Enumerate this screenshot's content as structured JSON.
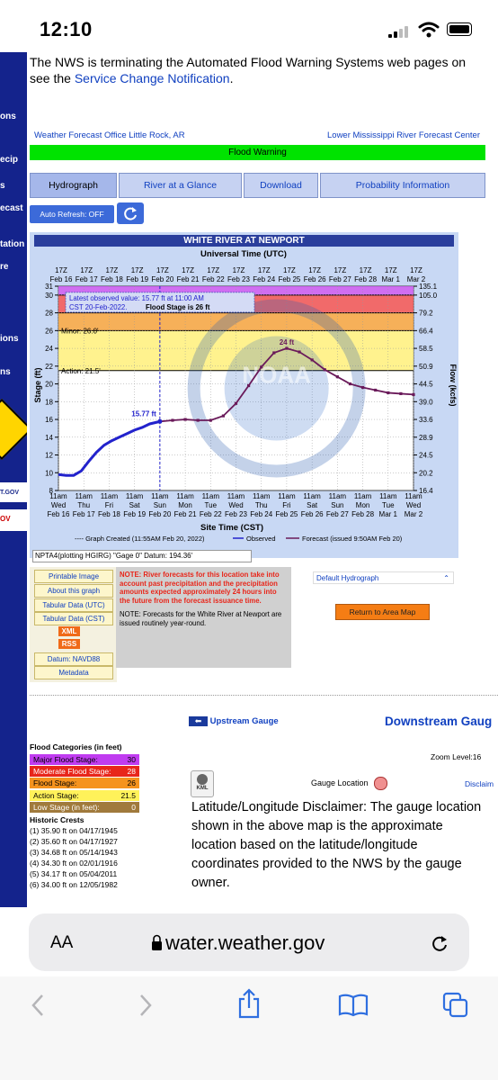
{
  "status_bar": {
    "time": "12:10"
  },
  "notice": {
    "line1": "The NWS is terminating the Automated Flood Warning Systems web pages on",
    "line2_prefix": "see the ",
    "line2_link": "Service Change Notification",
    "line2_suffix": "."
  },
  "left_nav": [
    "ons",
    "ecip",
    "s",
    "ecast",
    "tation",
    "re",
    "ions",
    "ns",
    "T.GOV",
    "OV"
  ],
  "header": {
    "office_link": "Weather Forecast Office Little Rock, AR",
    "rfc_link": "Lower Mississippi River Forecast Center",
    "banner": "Flood Warning"
  },
  "tabs": [
    "Hydrograph",
    "River at a Glance",
    "Download",
    "Probability Information"
  ],
  "auto_refresh": {
    "label": "Auto Refresh: OFF"
  },
  "chart": {
    "title": "WHITE RIVER AT NEWPORT",
    "top_axis_title": "Universal Time (UTC)",
    "top_ticks": [
      "17Z",
      "17Z",
      "17Z",
      "17Z",
      "17Z",
      "17Z",
      "17Z",
      "17Z",
      "17Z",
      "17Z",
      "17Z",
      "17Z",
      "17Z",
      "17Z",
      "17Z"
    ],
    "top_dates": [
      "Feb 16",
      "Feb 17",
      "Feb 18",
      "Feb 19",
      "Feb 20",
      "Feb 21",
      "Feb 22",
      "Feb 23",
      "Feb 24",
      "Feb 25",
      "Feb 26",
      "Feb 27",
      "Feb 28",
      "Mar 1",
      "Mar 2"
    ],
    "ylabel_left": "Stage (ft)",
    "ylabel_right": "Flow (kcfs)",
    "left_ticks": [
      "8",
      "10",
      "12",
      "14",
      "16",
      "18",
      "20",
      "22",
      "24",
      "26",
      "28",
      "30",
      "31"
    ],
    "right_ticks": [
      "16.4",
      "20.2",
      "24.5",
      "28.9",
      "33.6",
      "39.0",
      "44.5",
      "50.9",
      "58.5",
      "66.4",
      "79.2",
      "105.0",
      "135.1"
    ],
    "bottom_time_ticks": [
      "11am",
      "11am",
      "11am",
      "11am",
      "11am",
      "11am",
      "11am",
      "11am",
      "11am",
      "11am",
      "11am",
      "11am",
      "11am",
      "11am",
      "11am"
    ],
    "bottom_day_ticks": [
      "Wed",
      "Thu",
      "Fri",
      "Sat",
      "Sun",
      "Mon",
      "Tue",
      "Wed",
      "Thu",
      "Fri",
      "Sat",
      "Sun",
      "Mon",
      "Tue",
      "Wed"
    ],
    "bottom_date_ticks": [
      "Feb 16",
      "Feb 17",
      "Feb 18",
      "Feb 19",
      "Feb 20",
      "Feb 21",
      "Feb 22",
      "Feb 23",
      "Feb 24",
      "Feb 25",
      "Feb 26",
      "Feb 27",
      "Feb 28",
      "Mar 1",
      "Mar 2"
    ],
    "xlabel": "Site Time (CST)",
    "legend_created": "---- Graph Created (11:55AM Feb 20, 2022)",
    "legend_observed": "Observed",
    "legend_forecast": "Forecast (issued 9:50AM Feb 20)",
    "latest_line1": "Latest observed value: 15.77 ft at 11:00 AM",
    "latest_line2": "CST 20-Feb-2022.",
    "latest_flood": "Flood Stage is 26 ft",
    "minor_label": "Minor: 26.0'",
    "action_label": "Action: 21.5'",
    "obs_point_label": "15.77 ft",
    "crest_label": "24 ft",
    "noaa_text": "NOAA",
    "footer": "NPTA4(plotting HGIRG) \"Gage 0\" Datum: 194.36'"
  },
  "chart_data": {
    "type": "line",
    "title": "WHITE RIVER AT NEWPORT",
    "xlabel": "Site Time (CST)",
    "ylabel": "Stage (ft)",
    "ylim": [
      8,
      31
    ],
    "x_start": "Feb 16 11am",
    "x_end": "Mar 2 11am",
    "thresholds": {
      "major": 30,
      "moderate": 28,
      "minor": 26.0,
      "action": 21.5
    },
    "series": [
      {
        "name": "Observed",
        "color": "#2222cc",
        "x_days": [
          0.0,
          0.3,
          0.6,
          0.9,
          1.2,
          1.5,
          1.8,
          2.1,
          2.4,
          2.7,
          3.0,
          3.3,
          3.6,
          3.9,
          4.0
        ],
        "y": [
          9.8,
          9.7,
          9.7,
          10.2,
          11.3,
          12.3,
          13.1,
          13.6,
          14.0,
          14.4,
          14.8,
          15.1,
          15.5,
          15.7,
          15.77
        ]
      },
      {
        "name": "Forecast",
        "color": "#6a1a5a",
        "x_days": [
          4.0,
          4.5,
          5.0,
          5.5,
          6.0,
          6.5,
          7.0,
          7.5,
          8.0,
          8.5,
          9.0,
          9.5,
          10.0,
          10.5,
          11.0,
          11.5,
          12.0,
          12.5,
          13.0,
          13.5,
          14.0
        ],
        "y": [
          15.77,
          15.9,
          16.0,
          15.9,
          15.9,
          16.4,
          17.8,
          19.8,
          21.9,
          23.5,
          24.0,
          23.6,
          22.7,
          21.6,
          20.8,
          20.0,
          19.6,
          19.3,
          19.0,
          18.9,
          18.8
        ]
      }
    ]
  },
  "left_buttons": [
    "Printable Image",
    "About this graph",
    "Tabular Data (UTC)",
    "Tabular Data (CST)",
    "XML",
    "RSS",
    "Datum: NAVD88",
    "Metadata"
  ],
  "note_red": "NOTE: River forecasts for this location take into account past precipitation and the precipitation amounts expected approximately 24 hours into the future from the forecast issuance time.",
  "note_black": "NOTE: Forecasts for the White River at Newport are issued routinely year-round.",
  "select": {
    "value": "Default Hydrograph"
  },
  "return_btn": "Return to Area Map",
  "upstream": "Upstream Gauge",
  "downstream": "Downstream Gaug",
  "flood_categories": {
    "title": "Flood Categories (in feet)",
    "rows": [
      {
        "label": "Major Flood Stage:",
        "value": "30",
        "bg": "#c03cf0",
        "fg": "#000"
      },
      {
        "label": "Moderate Flood Stage:",
        "value": "28",
        "bg": "#e8261a",
        "fg": "#fff"
      },
      {
        "label": "Flood Stage:",
        "value": "26",
        "bg": "#f5931e",
        "fg": "#000"
      },
      {
        "label": "Action Stage:",
        "value": "21.5",
        "bg": "#fff25a",
        "fg": "#000"
      },
      {
        "label": "Low Stage (in feet):",
        "value": "0",
        "bg": "#a07a3c",
        "fg": "#fff"
      }
    ]
  },
  "historic": {
    "title": "Historic Crests",
    "items": [
      "(1) 35.90 ft on 04/17/1945",
      "(2) 35.60 ft on 04/17/1927",
      "(3) 34.68 ft on 05/14/1943",
      "(4) 34.30 ft on 02/01/1916",
      "(5) 34.17 ft on 05/04/2011",
      "(6) 34.00 ft on 12/05/1982"
    ]
  },
  "zoom": "Zoom Level:16",
  "disclaimer_link": "Disclaim",
  "kml": "KML",
  "gauge_location": "Gauge Location",
  "latlon_text": "Latitude/Longitude Disclaimer: The gauge location shown in the above map is the approximate location based on the latitude/longitude coordinates provided to the NWS by the gauge owner.",
  "browser": {
    "aa": "AA",
    "url": "water.weather.gov"
  }
}
